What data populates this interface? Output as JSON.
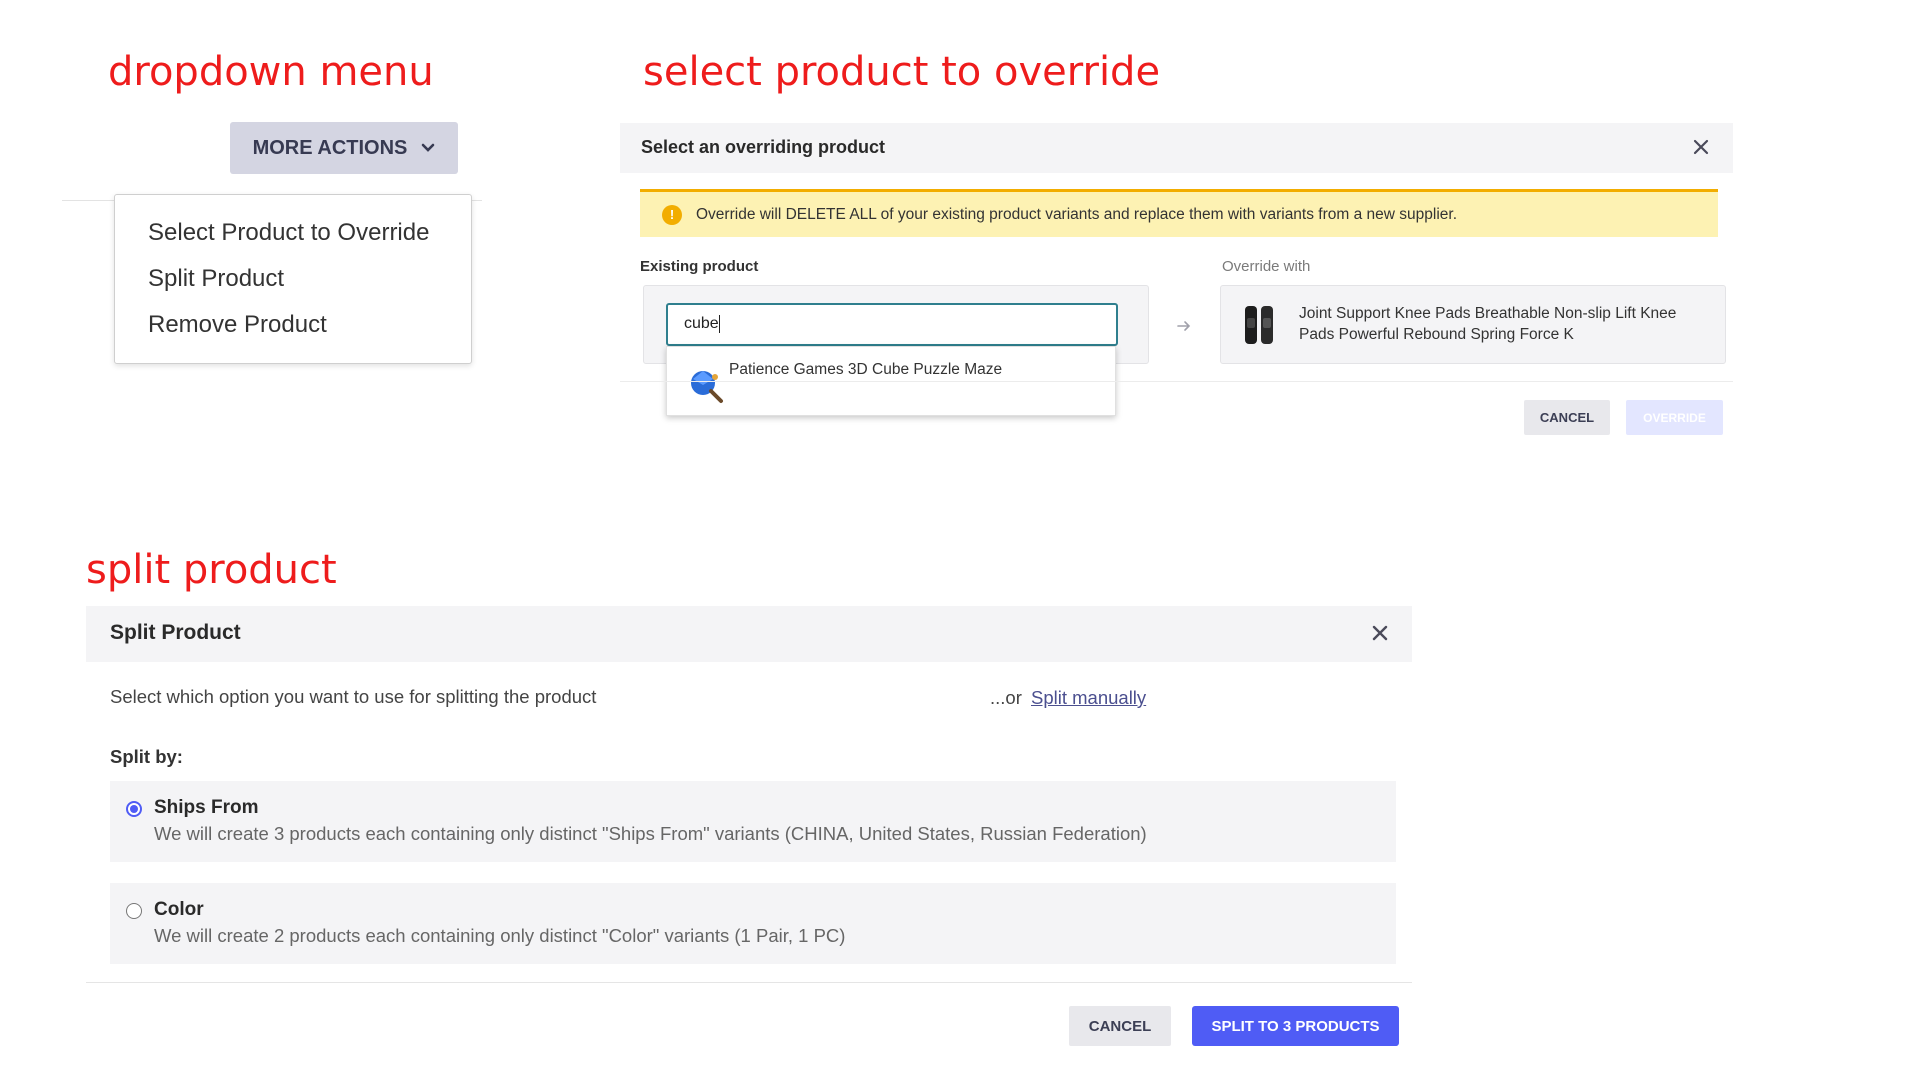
{
  "captions": {
    "dropdown": "dropdown menu",
    "override": "select product to override",
    "split": "split product"
  },
  "dropdown": {
    "button_label": "MORE ACTIONS",
    "items": [
      "Select Product to Override",
      "Split Product",
      "Remove Product"
    ]
  },
  "override_modal": {
    "title": "Select an overriding product",
    "warning": "Override will DELETE ALL of your existing product variants and replace them with variants from a new supplier.",
    "existing_label": "Existing product",
    "override_label": "Override with",
    "search_value": "cube",
    "suggestion": "Patience Games 3D Cube Puzzle Maze",
    "override_product_line1": "Joint Support Knee Pads Breathable Non-slip Lift Knee",
    "override_product_line2": "Pads Powerful Rebound Spring Force K",
    "cancel_label": "CANCEL",
    "override_button_label": "OVERRIDE"
  },
  "split_modal": {
    "title": "Split Product",
    "instruction": "Select which option you want to use for splitting the product",
    "or_text": "...or",
    "manual_link": "Split manually",
    "split_by_label": "Split by:",
    "options": [
      {
        "title": "Ships From",
        "description": "We will create 3 products each containing only distinct \"Ships From\" variants (CHINA, United States, Russian Federation)",
        "selected": true
      },
      {
        "title": "Color",
        "description": "We will create 2 products each containing only distinct \"Color\" variants (1 Pair, 1 PC)",
        "selected": false
      }
    ],
    "cancel_label": "CANCEL",
    "primary_label": "SPLIT TO 3 PRODUCTS"
  },
  "colors": {
    "caption": "#ee1c1c",
    "primary": "#4f5cf5",
    "warning_bar": "#f2ad00",
    "warning_bg": "#fdf2b3",
    "search_border": "#2f7f8e",
    "link": "#4b4f8f"
  }
}
